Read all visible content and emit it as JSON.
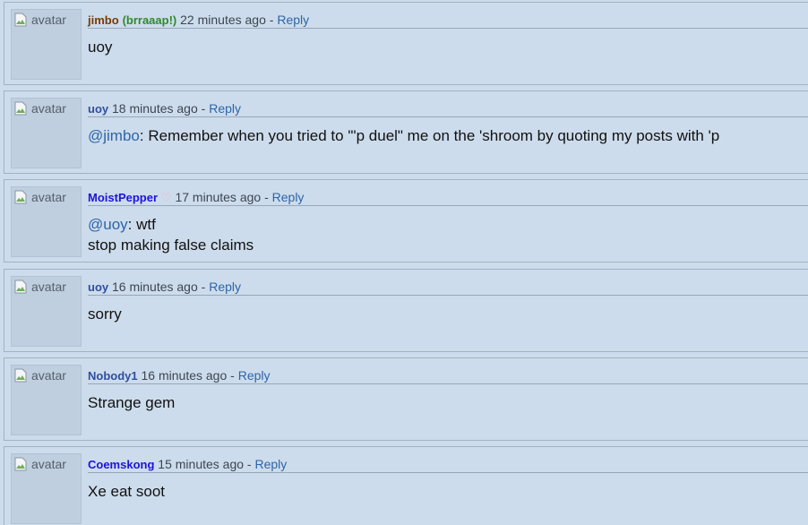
{
  "avatar_alt": "avatar",
  "reply_label": "Reply",
  "separator": "-",
  "colors": {
    "background": "#cddcec",
    "link": "#2d65a8",
    "username_brown": "#7a3a00",
    "username_blue": "#2d4f9e",
    "username_purple": "#1d14d9",
    "flair_green": "#2f8a2b",
    "heart_pink": "#f4b0c8"
  },
  "comments": [
    {
      "username": "jimbo",
      "flair": "(brraaap!)",
      "timestamp": "22 minutes ago",
      "body_line1": "uoy"
    },
    {
      "username": "uoy",
      "timestamp": "18 minutes ago",
      "mention": "@jimbo",
      "body_line1": ": Remember when you tried to \"'p duel\" me on the 'shroom by quoting my posts with 'p"
    },
    {
      "username": "MoistPepper",
      "heart": "♡",
      "timestamp": "17 minutes ago",
      "mention": "@uoy",
      "body_line1": ": wtf",
      "body_line2": "stop making false claims"
    },
    {
      "username": "uoy",
      "timestamp": "16 minutes ago",
      "body_line1": "sorry"
    },
    {
      "username": "Nobody1",
      "timestamp": "16 minutes ago",
      "body_line1": "Strange gem"
    },
    {
      "username": "Coemskong",
      "timestamp": "15 minutes ago",
      "body_line1": "Xe eat soot"
    }
  ]
}
